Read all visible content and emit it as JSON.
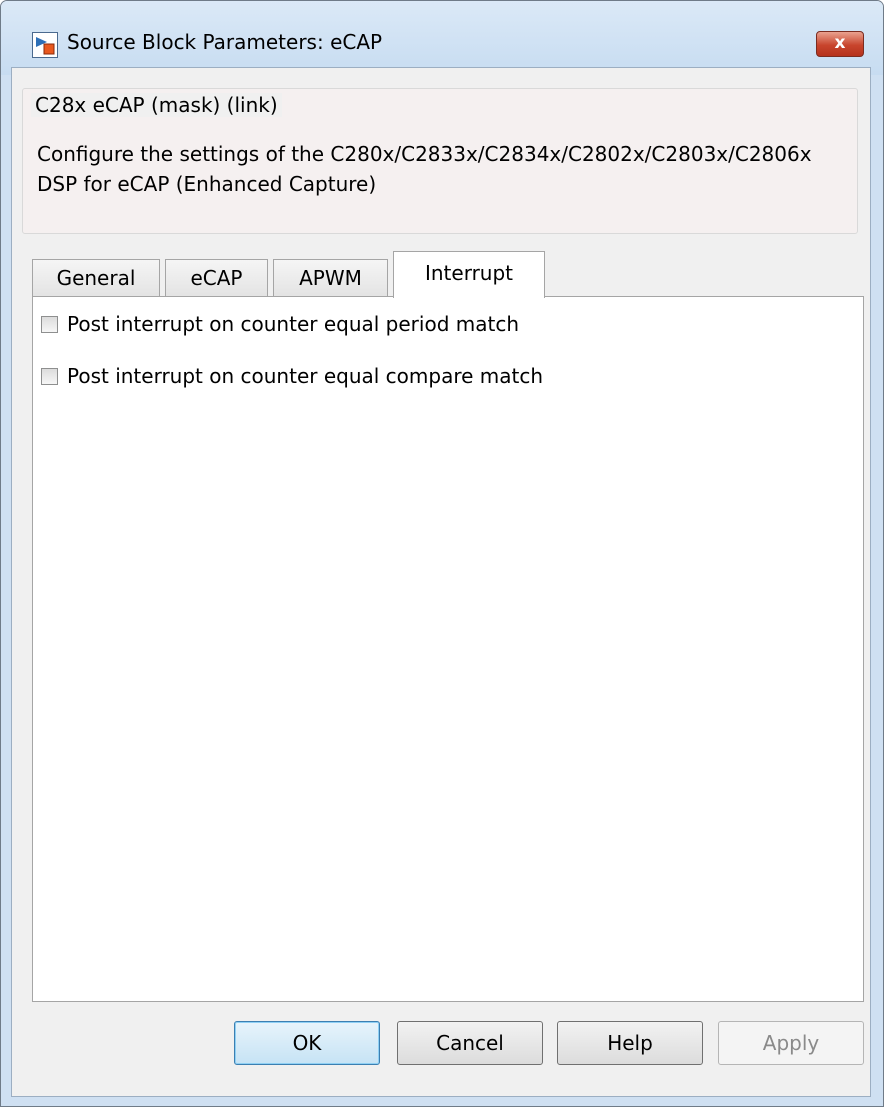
{
  "window": {
    "title": "Source Block Parameters: eCAP",
    "close_glyph": "x"
  },
  "mask": {
    "group_title": "C28x eCAP (mask) (link)",
    "description": "Configure the settings of the C280x/C2833x/C2834x/C2802x/C2803x/C2806x DSP for eCAP (Enhanced Capture)"
  },
  "tabs": [
    {
      "label": "General",
      "active": false
    },
    {
      "label": "eCAP",
      "active": false
    },
    {
      "label": "APWM",
      "active": false
    },
    {
      "label": "Interrupt",
      "active": true
    }
  ],
  "interrupt_panel": {
    "options": [
      {
        "label": "Post interrupt on counter equal period match",
        "checked": false
      },
      {
        "label": "Post interrupt on counter equal compare match",
        "checked": false
      }
    ]
  },
  "buttons": {
    "ok": "OK",
    "cancel": "Cancel",
    "help": "Help",
    "apply": "Apply"
  }
}
